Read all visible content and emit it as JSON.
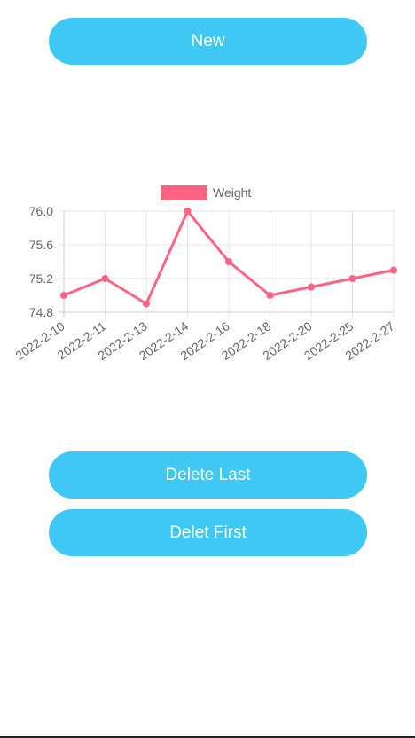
{
  "buttons": {
    "new_label": "New",
    "delete_last_label": "Delete Last",
    "delete_first_label": "Delet First"
  },
  "colors": {
    "button_bg": "#3ec8f3",
    "series": "#ff6384"
  },
  "chart_data": {
    "type": "line",
    "categories": [
      "2022-2-10",
      "2022-2-11",
      "2022-2-13",
      "2022-2-14",
      "2022-2-16",
      "2022-2-18",
      "2022-2-20",
      "2022-2-25",
      "2022-2-27"
    ],
    "series": [
      {
        "name": "Weight",
        "values": [
          75.0,
          75.2,
          74.9,
          76.0,
          75.4,
          75.0,
          75.1,
          75.2,
          75.3
        ]
      }
    ],
    "yticks": [
      "76.0",
      "75.6",
      "75.2",
      "74.8"
    ],
    "ylim": [
      74.8,
      76.0
    ],
    "grid": true,
    "legend": "top-center"
  }
}
